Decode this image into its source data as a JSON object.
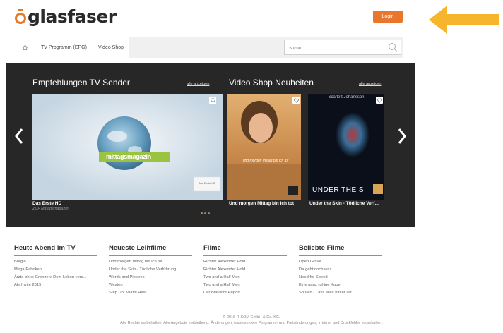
{
  "header": {
    "logo_text": "glasfaser",
    "login_label": "Login"
  },
  "nav": {
    "items": [
      {
        "label": ""
      },
      {
        "label": "TV Programm (EPG)"
      },
      {
        "label": "Video Shop"
      }
    ],
    "search_placeholder": "Suche..."
  },
  "slider": {
    "tv_title": "Empfehlungen TV Sender",
    "tv_show_all": "alle anzeigen",
    "video_title": "Video Shop Neuheiten",
    "video_show_all": "alle anzeigen",
    "tv_card": {
      "channel": "Das Erste HD",
      "subtitle": "ZDF Mittagsmagazin",
      "overlay": "mittagsmagazin",
      "logo": "Das Erste HD"
    },
    "videos": [
      {
        "title": "Und morgen Mittag bin ich tot",
        "poster_caption": "und morgen mittag bin ich tot"
      },
      {
        "title": "Under the Skin - Tödliche Verf...",
        "poster_top": "Scarlett Johansson",
        "poster_caption": "UNDER THE S"
      }
    ]
  },
  "columns": [
    {
      "heading": "Heute Abend im TV",
      "items": [
        "Borgia",
        "Mega-Fabriken",
        "Ärzte ohne Grenzen: Dem Leben vers...",
        "Ale Invite 2015"
      ]
    },
    {
      "heading": "Neueste Leihfilme",
      "items": [
        "Und morgen Mittag bin ich tot",
        "Under the Skin - Tödliche Verführung",
        "Words and Pictures",
        "Westen",
        "Step Up: Miami Heat"
      ]
    },
    {
      "heading": "Filme",
      "items": [
        "Richter Alexander Hold",
        "Richter Alexander Hold",
        "Two and a Half Men",
        "Two and a Half Men",
        "Der Blaulicht Report"
      ]
    },
    {
      "heading": "Beliebte Filme",
      "items": [
        "Open Grave",
        "Da geht noch was",
        "Need for Speed",
        "Eine ganz ruhige Kugel",
        "Spuren - Lass alles hinter Dir"
      ]
    }
  ],
  "footer": {
    "copyright": "© 2016 R-KOM GmbH & Co. KG.",
    "legal": "Alle Rechte vorbehalten. Alle Angebote freibleibend. Änderungen, insbesondere Programm- und Preisänderungen, Irrtümer und Druckfehler vorbehalten."
  },
  "colors": {
    "accent": "#e8772b",
    "stage": "#272727"
  }
}
